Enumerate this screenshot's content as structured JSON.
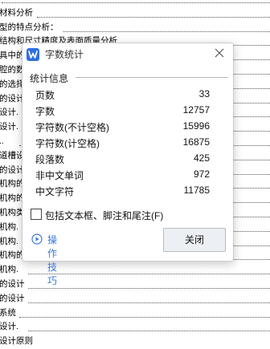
{
  "document": {
    "lines": [
      {
        "text": "",
        "dots": true
      },
      {
        "text": "材料分析",
        "dots": true
      },
      {
        "text": "型的特点分析：",
        "dots": true
      },
      {
        "text": "结构和尺寸精度及表面质量分析",
        "dots": true
      },
      {
        "text": "具中的",
        "dots": true
      },
      {
        "text": "腔的数",
        "dots": true
      },
      {
        "text": "的选择",
        "dots": true
      },
      {
        "text": "的设计",
        "dots": true
      },
      {
        "text": "设计.",
        "dots": true
      },
      {
        "text": "设计.",
        "dots": true
      },
      {
        "text": "..",
        "dots": true
      },
      {
        "text": "道槽设计",
        "dots": true
      },
      {
        "text": "的设计",
        "dots": true
      },
      {
        "text": "机构的",
        "dots": true
      },
      {
        "text": "机构的",
        "dots": true
      },
      {
        "text": "机构类",
        "dots": true
      },
      {
        "text": "机构.",
        "dots": true
      },
      {
        "text": "机构.",
        "dots": true
      },
      {
        "text": "机构的",
        "dots": true
      },
      {
        "text": "机构.",
        "dots": true
      },
      {
        "text": "的设计",
        "dots": true
      },
      {
        "text": "的设计",
        "dots": true
      },
      {
        "text": "系统",
        "dots": true
      },
      {
        "text": "设计.",
        "dots": true
      },
      {
        "text": "设计原则",
        "dots": false
      }
    ]
  },
  "dialog": {
    "title": "字数统计",
    "section_header": "统计信息",
    "stats": [
      {
        "label": "页数",
        "value": "33"
      },
      {
        "label": "字数",
        "value": "12757"
      },
      {
        "label": "字符数(不计空格)",
        "value": "15996"
      },
      {
        "label": "字符数(计空格)",
        "value": "16875"
      },
      {
        "label": "段落数",
        "value": "425"
      },
      {
        "label": "非中文单词",
        "value": "972"
      },
      {
        "label": "中文字符",
        "value": "11785"
      }
    ],
    "include_checkbox_label": "包括文本框、脚注和尾注(F)",
    "include_checked": false,
    "tips_label": "操作技巧",
    "close_label": "关闭",
    "accent_color": "#2f6fe0",
    "link_color": "#3b78d8"
  }
}
